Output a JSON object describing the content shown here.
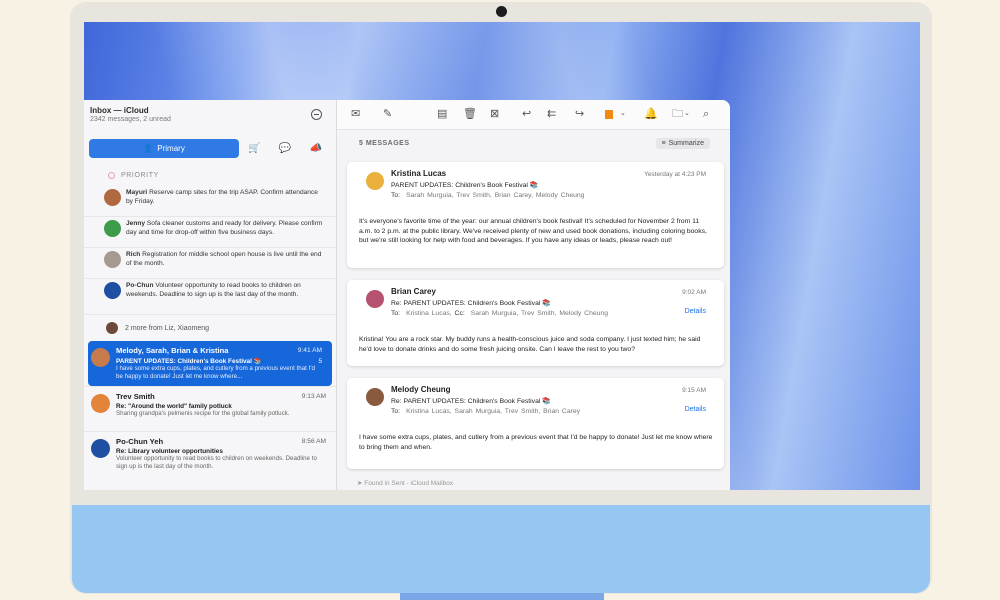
{
  "sidebar": {
    "mailbox_title": "Inbox — iCloud",
    "mailbox_sub": "2342 messages, 2 unread",
    "primary_label": "Primary",
    "priority_label": "PRIORITY",
    "priority_items": [
      {
        "name": "Mayuri",
        "text": "Reserve camp sites for the trip ASAP. Confirm attendance by Friday."
      },
      {
        "name": "Jenny",
        "text": "Sofa cleaner customs and ready for delivery. Please confirm day and time for drop-off within five business days."
      },
      {
        "name": "Rich",
        "text": "Registration for middle school open house is live until the end of the month."
      },
      {
        "name": "Po-Chun",
        "text": "Volunteer opportunity to read books to children on weekends. Deadline to sign up is the last day of the month."
      }
    ],
    "more_text": "2 more from Liz, Xiaomeng",
    "messages": [
      {
        "from": "Melody, Sarah, Brian & Kristina",
        "time": "9:41 AM",
        "subject": "PARENT UPDATES: Children's Book Festival 📚",
        "preview": "I have some extra cups, plates, and cutlery from a previous event that I'd be happy to donate! Just let me know where...",
        "count": "5"
      },
      {
        "from": "Trev Smith",
        "time": "9:13 AM",
        "subject": "Re: \"Around the world\" family potluck",
        "preview": "Sharing grandpa's pelmenis recipe for the global family potluck."
      },
      {
        "from": "Po-Chun Yeh",
        "time": "8:56 AM",
        "subject": "Re: Library volunteer opportunities",
        "preview": "Volunteer opportunity to read books to children on weekends. Deadline to sign up is the last day of the month."
      }
    ]
  },
  "main": {
    "count_label": "5 MESSAGES",
    "summarize_label": "Summarize",
    "found_text": "Found in Sent - iCloud Mailbox",
    "cards": [
      {
        "from": "Kristina Lucas",
        "time": "Yesterday at 4:23 PM",
        "subject": "PARENT UPDATES: Children's Book Festival 📚",
        "to_label": "To:",
        "to": "Sarah Murguia,   Trev Smith,   Brian Carey,   Melody Cheung",
        "body": "It's everyone's favorite time of the year: our annual children's book festival! It's scheduled for November 2 from 11 a.m. to 2 p.m. at the public library. We've received plenty of new and used book donations, including coloring books, but we're still looking for help with food and beverages. If you have any ideas or leads, please reach out!"
      },
      {
        "from": "Brian Carey",
        "time": "9:02 AM",
        "subject": "Re: PARENT UPDATES: Children's Book Festival 📚",
        "to_label": "To:",
        "to": "Kristina Lucas,",
        "cc_label": "Cc:",
        "cc": "Sarah Murguia,   Trev Smith,   Melody Cheung",
        "details": "Details",
        "body": "Kristina! You are a rock star. My buddy runs a health-conscious juice and soda company. I just texted him; he said he'd love to donate drinks and do some fresh juicing onsite. Can I leave the rest to you two?"
      },
      {
        "from": "Melody Cheung",
        "time": "9:15 AM",
        "subject": "Re: PARENT UPDATES: Children's Book Festival 📚",
        "to_label": "To:",
        "to": "Kristina Lucas,   Sarah Murguia,   Trev Smith,   Brian Carey",
        "details": "Details",
        "body": "I have some extra cups, plates, and cutlery from a previous event that I'd be happy to donate! Just let me know where to bring them and when."
      }
    ]
  },
  "colors": {
    "accent": "#2f7ae5",
    "selected": "#1667d9",
    "flag": "#f08a11"
  }
}
